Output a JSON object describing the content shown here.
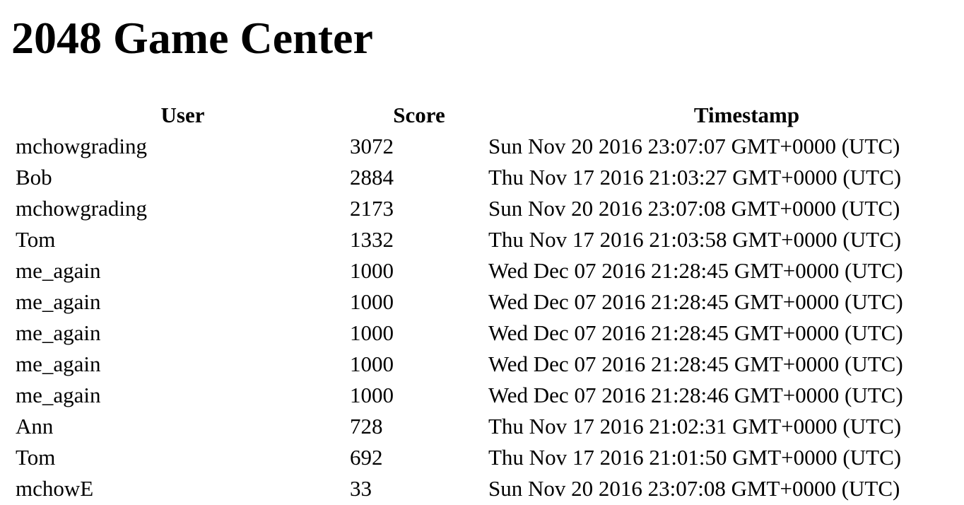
{
  "page": {
    "title": "2048 Game Center"
  },
  "table": {
    "headers": {
      "user": "User",
      "score": "Score",
      "time": "Timestamp"
    },
    "rows": [
      {
        "user": "mchowgrading",
        "score": "3072",
        "time": "Sun Nov 20 2016 23:07:07 GMT+0000 (UTC)"
      },
      {
        "user": "Bob",
        "score": "2884",
        "time": "Thu Nov 17 2016 21:03:27 GMT+0000 (UTC)"
      },
      {
        "user": "mchowgrading",
        "score": "2173",
        "time": "Sun Nov 20 2016 23:07:08 GMT+0000 (UTC)"
      },
      {
        "user": "Tom",
        "score": "1332",
        "time": "Thu Nov 17 2016 21:03:58 GMT+0000 (UTC)"
      },
      {
        "user": "me_again",
        "score": "1000",
        "time": "Wed Dec 07 2016 21:28:45 GMT+0000 (UTC)"
      },
      {
        "user": "me_again",
        "score": "1000",
        "time": "Wed Dec 07 2016 21:28:45 GMT+0000 (UTC)"
      },
      {
        "user": "me_again",
        "score": "1000",
        "time": "Wed Dec 07 2016 21:28:45 GMT+0000 (UTC)"
      },
      {
        "user": "me_again",
        "score": "1000",
        "time": "Wed Dec 07 2016 21:28:45 GMT+0000 (UTC)"
      },
      {
        "user": "me_again",
        "score": "1000",
        "time": "Wed Dec 07 2016 21:28:46 GMT+0000 (UTC)"
      },
      {
        "user": "Ann",
        "score": "728",
        "time": "Thu Nov 17 2016 21:02:31 GMT+0000 (UTC)"
      },
      {
        "user": "Tom",
        "score": "692",
        "time": "Thu Nov 17 2016 21:01:50 GMT+0000 (UTC)"
      },
      {
        "user": "mchowE",
        "score": "33",
        "time": "Sun Nov 20 2016 23:07:08 GMT+0000 (UTC)"
      }
    ]
  }
}
